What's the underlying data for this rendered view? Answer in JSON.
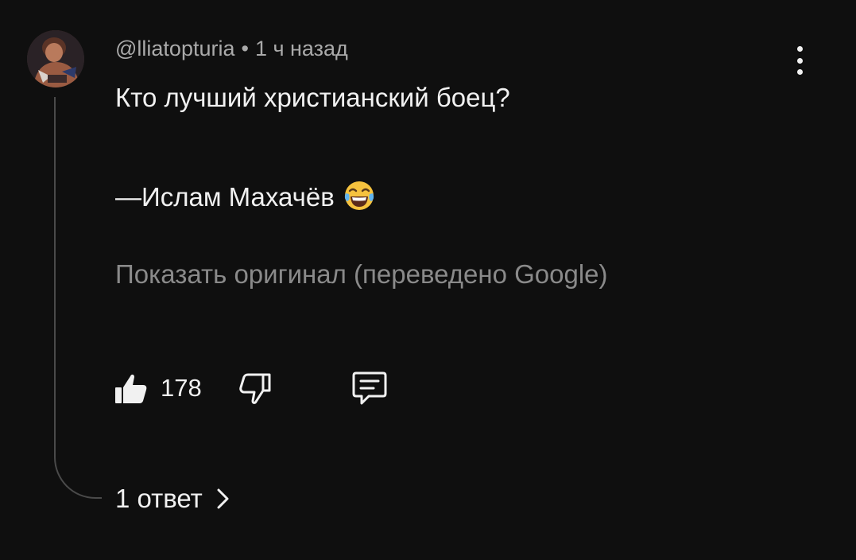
{
  "comment": {
    "author": "@lliatopturia",
    "separator": "•",
    "time": "1 ч назад",
    "line1": "Кто лучший христианский боец?",
    "line2": "—Ислам Махачёв",
    "emoji": "tears-of-joy-emoji",
    "translate_link": "Показать оригинал (переведено Google)",
    "likes": "178",
    "replies_label": "1 ответ"
  },
  "icons": {
    "menu": "more-vertical-icon",
    "like": "thumb-up-icon",
    "dislike": "thumb-down-icon",
    "reply": "comment-icon",
    "replies_chevron": "chevron-right-icon"
  },
  "colors": {
    "background": "#0f0f0f",
    "primary_text": "#f1f1f1",
    "secondary_text": "#aaaaaa",
    "muted_text": "#8a8a8a",
    "thread_line": "#4a4a4a"
  }
}
